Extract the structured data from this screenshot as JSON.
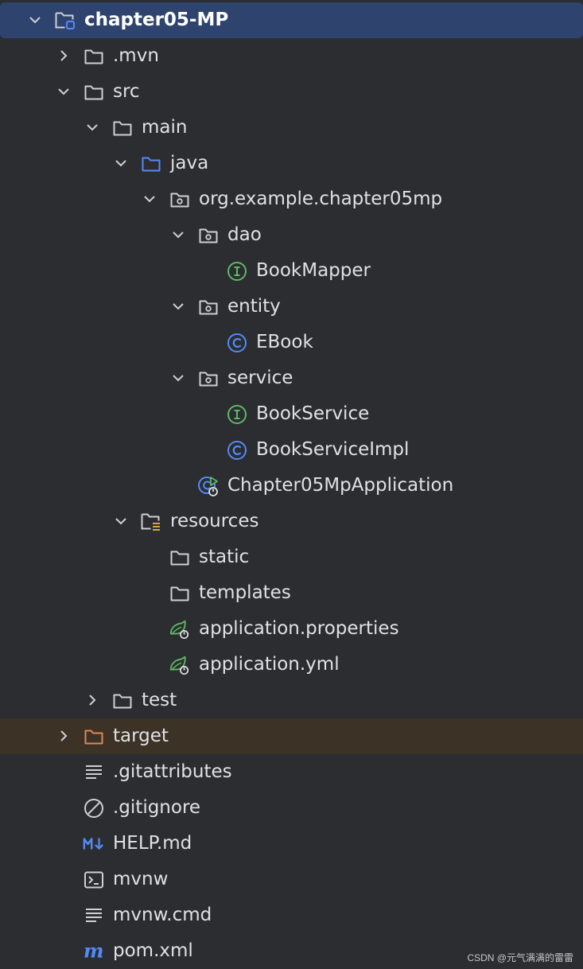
{
  "project": {
    "items": [
      {
        "label": "chapter05-MP",
        "icon": "module-folder-icon",
        "chevron": "down",
        "depth": 0,
        "state": "selected"
      },
      {
        "label": ".mvn",
        "icon": "folder-icon",
        "chevron": "right",
        "depth": 1
      },
      {
        "label": "src",
        "icon": "folder-icon",
        "chevron": "down",
        "depth": 1
      },
      {
        "label": "main",
        "icon": "folder-icon",
        "chevron": "down",
        "depth": 2
      },
      {
        "label": "java",
        "icon": "source-folder-icon",
        "chevron": "down",
        "depth": 3
      },
      {
        "label": "org.example.chapter05mp",
        "icon": "package-icon",
        "chevron": "down",
        "depth": 4
      },
      {
        "label": "dao",
        "icon": "package-icon",
        "chevron": "down",
        "depth": 5
      },
      {
        "label": "BookMapper",
        "icon": "interface-icon",
        "depth": 6
      },
      {
        "label": "entity",
        "icon": "package-icon",
        "chevron": "down",
        "depth": 5
      },
      {
        "label": "EBook",
        "icon": "class-icon",
        "depth": 6
      },
      {
        "label": "service",
        "icon": "package-icon",
        "chevron": "down",
        "depth": 5
      },
      {
        "label": "BookService",
        "icon": "interface-icon",
        "depth": 6
      },
      {
        "label": "BookServiceImpl",
        "icon": "class-icon",
        "depth": 6
      },
      {
        "label": "Chapter05MpApplication",
        "icon": "spring-boot-class-icon",
        "depth": 5
      },
      {
        "label": "resources",
        "icon": "resources-folder-icon",
        "chevron": "down",
        "depth": 3
      },
      {
        "label": "static",
        "icon": "folder-icon",
        "depth": 4
      },
      {
        "label": "templates",
        "icon": "folder-icon",
        "depth": 4
      },
      {
        "label": "application.properties",
        "icon": "spring-config-icon",
        "depth": 4
      },
      {
        "label": "application.yml",
        "icon": "spring-config-icon",
        "depth": 4
      },
      {
        "label": "test",
        "icon": "folder-icon",
        "chevron": "right",
        "depth": 2
      },
      {
        "label": "target",
        "icon": "excluded-folder-icon",
        "chevron": "right",
        "depth": 1,
        "state": "excluded"
      },
      {
        "label": ".gitattributes",
        "icon": "text-file-icon",
        "depth": 1
      },
      {
        "label": ".gitignore",
        "icon": "ignore-file-icon",
        "depth": 1
      },
      {
        "label": "HELP.md",
        "icon": "markdown-icon",
        "depth": 1
      },
      {
        "label": "mvnw",
        "icon": "shell-script-icon",
        "depth": 1
      },
      {
        "label": "mvnw.cmd",
        "icon": "text-file-icon",
        "depth": 1
      },
      {
        "label": "pom.xml",
        "icon": "maven-icon",
        "depth": 1
      }
    ]
  },
  "watermark": "CSDN @元气满满的雷雷",
  "colors": {
    "background": "#2b2d30",
    "selected_row": "#2e436e",
    "excluded_row": "#3c3226",
    "folder_stroke": "#ced0d6",
    "source_folder": "#548af7",
    "interface": "#5fb865",
    "class": "#548af7",
    "excluded_folder": "#e08855",
    "spring": "#5fb865"
  }
}
